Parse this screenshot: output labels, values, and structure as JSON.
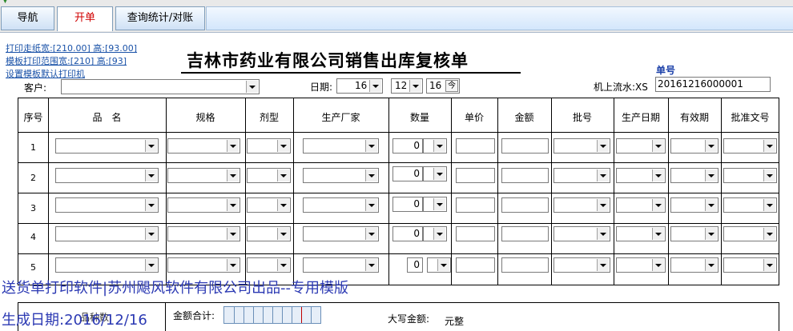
{
  "tabs": [
    {
      "label": "导航"
    },
    {
      "label": "开单"
    },
    {
      "label": "查询统计/对账"
    }
  ],
  "links": {
    "print_paper": "打印走纸宽:[210.00] 高:[93.00]",
    "template_range": "模板打印范围宽:[210] 高:[93]",
    "set_default_printer": "设置模板默认打印机"
  },
  "document": {
    "title": "吉林市药业有限公司销售出库复核单",
    "doc_no_label": "单号",
    "customer_label": "客户:",
    "date_label": "日期:",
    "date_year": "16",
    "date_month": "12",
    "date_day": "16",
    "date_today_glyph": "今",
    "serial_label": "机上流水:",
    "serial_prefix": "XS",
    "serial_value": "20161216000001"
  },
  "table": {
    "headers": [
      "序号",
      "品　名",
      "规格",
      "剂型",
      "生产厂家",
      "数量",
      "单价",
      "金额",
      "批号",
      "生产日期",
      "有效期",
      "批准文号"
    ],
    "rows": [
      {
        "no": "1",
        "qty": "0"
      },
      {
        "no": "2",
        "qty": "0"
      },
      {
        "no": "3",
        "qty": "0"
      },
      {
        "no": "4",
        "qty": "0"
      },
      {
        "no": "5",
        "qty": "0"
      }
    ]
  },
  "footer": {
    "amount_total_label": "金额合计:",
    "big_amount_label": "大写金额:",
    "big_amount_value": "元整",
    "partial_label": "品种数:"
  },
  "overlay": {
    "watermark_line1": "送货单打印软件|苏州飓风软件有限公司出品--专用模版",
    "watermark_line2": "生成日期:2016/12/16"
  }
}
